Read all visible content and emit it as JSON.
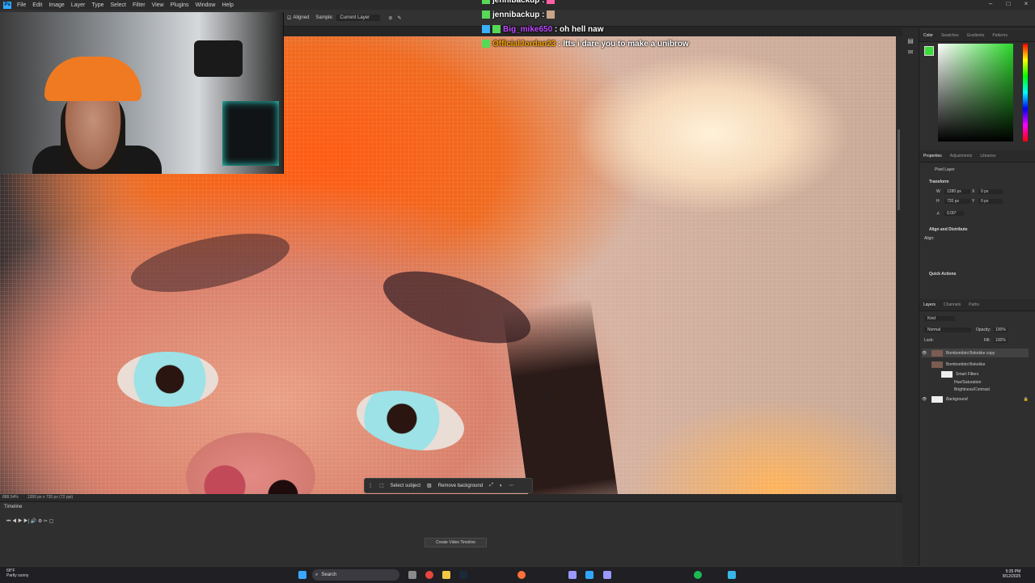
{
  "menubar": {
    "app_icon": "Ps",
    "items": [
      "File",
      "Edit",
      "Image",
      "Layer",
      "Type",
      "Select",
      "Filter",
      "View",
      "Plugins",
      "Window",
      "Help"
    ]
  },
  "options_bar": {
    "aligned_label": "Aligned",
    "sample_label": "Sample:",
    "sample_value": "Current Layer"
  },
  "chat": [
    {
      "user": "jennibackup",
      "message": "",
      "color": "#ffffff",
      "badge_color": "#ff5fa8"
    },
    {
      "user": "jennibackup",
      "message": "",
      "color": "#ffffff",
      "badge_color": "#c8a488"
    },
    {
      "user": "Big_mike650",
      "message": "oh hell naw",
      "color": "#c04bff",
      "badge_color": "#3ab0ff"
    },
    {
      "user": "OfficialJordan23",
      "message": "Itts i dare you to make a unibrow",
      "color": "#f7a400",
      "badge_color": "#57d957"
    }
  ],
  "context_bar": {
    "select_subject": "Select subject",
    "remove_background": "Remove background"
  },
  "status_bar": {
    "zoom": "888.54%",
    "doc_size": "1280 px x 720 px (72 ppi)"
  },
  "color_panel": {
    "tabs": [
      "Color",
      "Swatches",
      "Gradients",
      "Patterns"
    ],
    "foreground": "#3adc3a"
  },
  "properties_panel": {
    "tabs": [
      "Properties",
      "Adjustments",
      "Libraries"
    ],
    "kind": "Pixel Layer",
    "transform_heading": "Transform",
    "w": "1280 px",
    "h": "720 px",
    "x": "0 px",
    "y": "0 px",
    "angle": "0.00°",
    "align_heading": "Align and Distribute",
    "align_sub": "Align:",
    "quick_actions": "Quick Actions"
  },
  "layers_panel": {
    "tabs": [
      "Layers",
      "Channels",
      "Paths"
    ],
    "kind_filter": "Kind",
    "blend_mode": "Normal",
    "opacity_label": "Opacity:",
    "opacity": "100%",
    "lock_label": "Lock:",
    "fill_label": "Fill:",
    "fill": "100%",
    "layers": [
      {
        "name": "Bombombini Bokekke copy",
        "indent": 0
      },
      {
        "name": "Bombombini Bokekke",
        "indent": 0
      },
      {
        "name": "Smart Filters",
        "indent": 1
      },
      {
        "name": "Hue/Saturation",
        "indent": 2
      },
      {
        "name": "Brightness/Contrast",
        "indent": 2
      },
      {
        "name": "Background",
        "indent": 0
      }
    ]
  },
  "timeline": {
    "label": "Timeline",
    "create_button": "Create Video Timeline"
  },
  "taskbar": {
    "temp": "68°F",
    "weather": "Partly sunny",
    "search": "Search",
    "time": "5:35 PM",
    "date": "8/12/2025"
  }
}
